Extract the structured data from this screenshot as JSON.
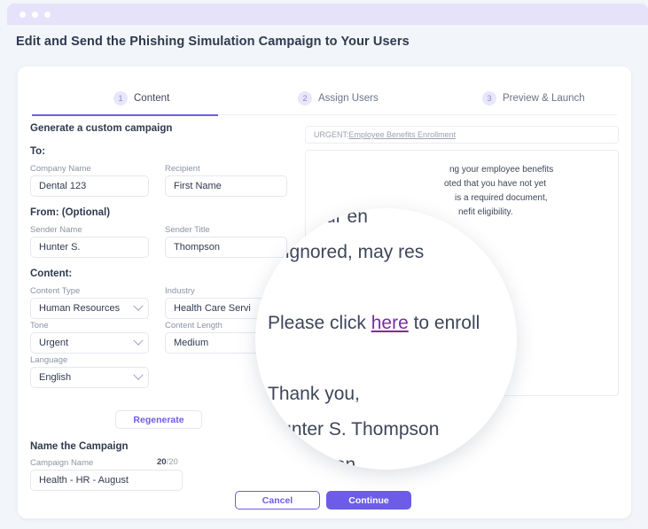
{
  "window": {
    "dots": [
      "dot-1",
      "dot-2",
      "dot-3"
    ]
  },
  "page_title": "Edit and Send the Phishing Simulation Campaign to Your Users",
  "stepper": {
    "steps": [
      {
        "num": "1",
        "label": "Content",
        "active": true
      },
      {
        "num": "2",
        "label": "Assign Users",
        "active": false
      },
      {
        "num": "3",
        "label": "Preview & Launch",
        "active": false
      }
    ]
  },
  "form": {
    "generate_heading": "Generate a custom campaign",
    "to_heading": "To:",
    "company_name_label": "Company Name",
    "company_name_value": "Dental 123",
    "recipient_label": "Recipient",
    "recipient_value": "First Name",
    "from_heading": "From: (Optional)",
    "sender_name_label": "Sender Name",
    "sender_name_value": "Hunter S.",
    "sender_title_label": "Sender Title",
    "sender_title_value": "Thompson",
    "content_heading": "Content:",
    "content_type_label": "Content Type",
    "content_type_value": "Human Resources",
    "industry_label": "Industry",
    "industry_value": "Health Care Servi",
    "tone_label": "Tone",
    "tone_value": "Urgent",
    "content_length_label": "Content Length",
    "content_length_value": "Medium",
    "language_label": "Language",
    "language_value": "English",
    "regenerate_label": "Regenerate",
    "name_campaign_heading": "Name the Campaign",
    "campaign_name_label": "Campaign Name",
    "campaign_name_value": "Health - HR - August",
    "char_count_used": "20",
    "char_count_total": "/20"
  },
  "email_preview": {
    "subject_prefix": "URGENT: ",
    "subject_underlined": "Employee Benefits Enrollment",
    "body_lines": [
      "",
      "",
      "ng your employee benefits",
      "oted that you have not yet",
      "is a required document,",
      "nefit eligibility."
    ]
  },
  "magnifier": {
    "line_1": "tted your en",
    "line_2": "u if ignored, may res",
    "click_prefix": "Please click ",
    "click_link": "here",
    "click_suffix": " to enroll",
    "thanks": "Thank you,",
    "sender_full": "Hunter S. Thompson",
    "sender_last": "Thompson"
  },
  "footer": {
    "cancel_label": "Cancel",
    "continue_label": "Continue"
  },
  "colors": {
    "accent": "#6c5ce7",
    "chrome_bar": "#e6e2fa",
    "link": "#7b2d9e",
    "page_bg": "#f2f5f9"
  }
}
